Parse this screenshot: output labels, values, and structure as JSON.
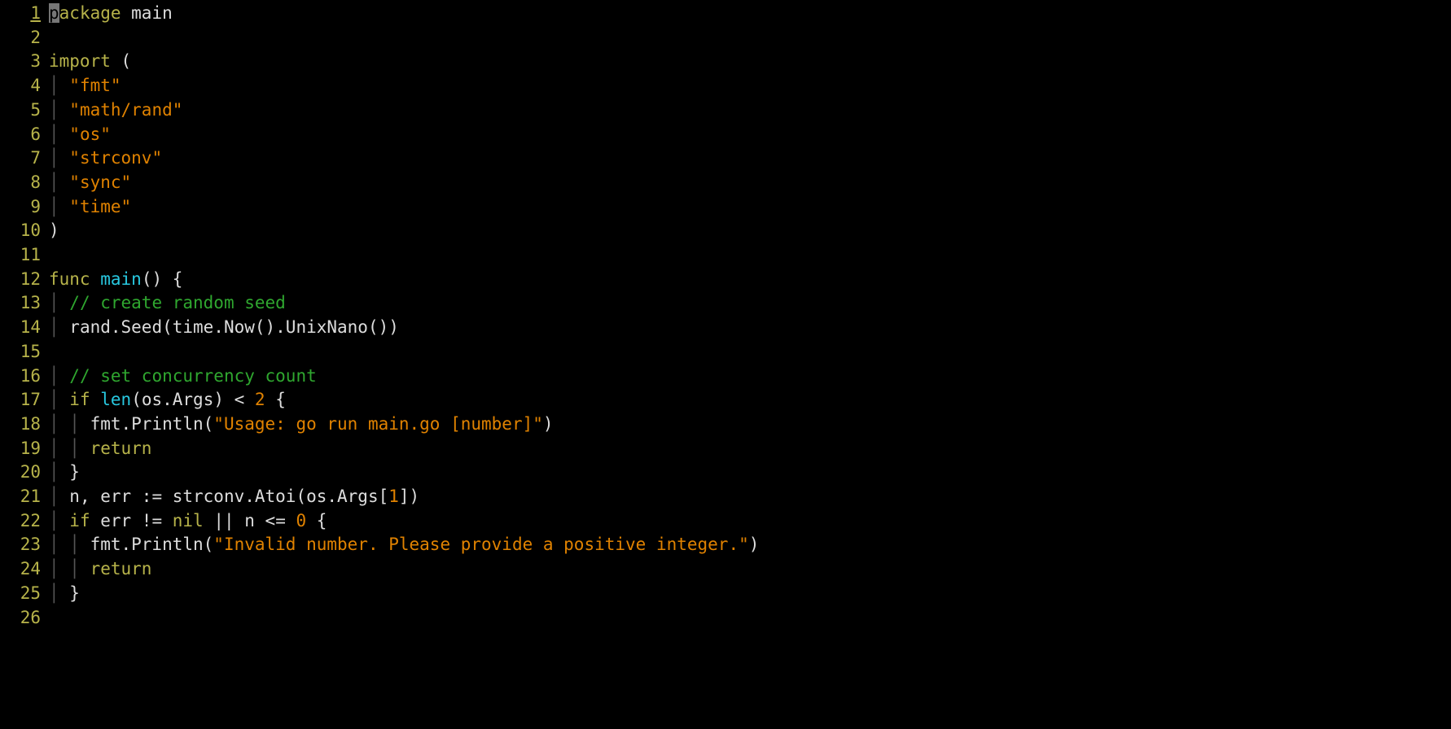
{
  "editor": {
    "cursor_line": 1,
    "lines": [
      {
        "n": 1,
        "tokens": [
          {
            "t": "cursor",
            "v": "p"
          },
          {
            "t": "kw",
            "v": "ackage"
          },
          {
            "t": "id",
            "v": " main"
          }
        ]
      },
      {
        "n": 2,
        "tokens": []
      },
      {
        "n": 3,
        "tokens": [
          {
            "t": "kw",
            "v": "import"
          },
          {
            "t": "id",
            "v": " "
          },
          {
            "t": "paren",
            "v": "("
          }
        ]
      },
      {
        "n": 4,
        "tokens": [
          {
            "t": "pipe",
            "v": "│ "
          },
          {
            "t": "str",
            "v": "\"fmt\""
          }
        ]
      },
      {
        "n": 5,
        "tokens": [
          {
            "t": "pipe",
            "v": "│ "
          },
          {
            "t": "str",
            "v": "\"math/rand\""
          }
        ]
      },
      {
        "n": 6,
        "tokens": [
          {
            "t": "pipe",
            "v": "│ "
          },
          {
            "t": "str",
            "v": "\"os\""
          }
        ]
      },
      {
        "n": 7,
        "tokens": [
          {
            "t": "pipe",
            "v": "│ "
          },
          {
            "t": "str",
            "v": "\"strconv\""
          }
        ]
      },
      {
        "n": 8,
        "tokens": [
          {
            "t": "pipe",
            "v": "│ "
          },
          {
            "t": "str",
            "v": "\"sync\""
          }
        ]
      },
      {
        "n": 9,
        "tokens": [
          {
            "t": "pipe",
            "v": "│ "
          },
          {
            "t": "str",
            "v": "\"time\""
          }
        ]
      },
      {
        "n": 10,
        "tokens": [
          {
            "t": "paren",
            "v": ")"
          }
        ]
      },
      {
        "n": 11,
        "tokens": []
      },
      {
        "n": 12,
        "tokens": [
          {
            "t": "kw",
            "v": "func"
          },
          {
            "t": "id",
            "v": " "
          },
          {
            "t": "builtin",
            "v": "main"
          },
          {
            "t": "paren",
            "v": "()"
          },
          {
            "t": "id",
            "v": " "
          },
          {
            "t": "paren",
            "v": "{"
          }
        ]
      },
      {
        "n": 13,
        "tokens": [
          {
            "t": "pipe",
            "v": "│ "
          },
          {
            "t": "cmt",
            "v": "// create random seed"
          }
        ]
      },
      {
        "n": 14,
        "tokens": [
          {
            "t": "pipe",
            "v": "│ "
          },
          {
            "t": "id",
            "v": "rand.Seed(time.Now().UnixNano())"
          }
        ]
      },
      {
        "n": 15,
        "tokens": []
      },
      {
        "n": 16,
        "tokens": [
          {
            "t": "pipe",
            "v": "│ "
          },
          {
            "t": "cmt",
            "v": "// set concurrency count"
          }
        ]
      },
      {
        "n": 17,
        "tokens": [
          {
            "t": "pipe",
            "v": "│ "
          },
          {
            "t": "kw",
            "v": "if"
          },
          {
            "t": "id",
            "v": " "
          },
          {
            "t": "builtin",
            "v": "len"
          },
          {
            "t": "id",
            "v": "(os.Args) < "
          },
          {
            "t": "num",
            "v": "2"
          },
          {
            "t": "id",
            "v": " "
          },
          {
            "t": "paren",
            "v": "{"
          }
        ]
      },
      {
        "n": 18,
        "tokens": [
          {
            "t": "pipe",
            "v": "│ │ "
          },
          {
            "t": "id",
            "v": "fmt.Println("
          },
          {
            "t": "str",
            "v": "\"Usage: go run main.go [number]\""
          },
          {
            "t": "id",
            "v": ")"
          }
        ]
      },
      {
        "n": 19,
        "tokens": [
          {
            "t": "pipe",
            "v": "│ │ "
          },
          {
            "t": "kw",
            "v": "return"
          }
        ]
      },
      {
        "n": 20,
        "tokens": [
          {
            "t": "pipe",
            "v": "│ "
          },
          {
            "t": "paren",
            "v": "}"
          }
        ]
      },
      {
        "n": 21,
        "tokens": [
          {
            "t": "pipe",
            "v": "│ "
          },
          {
            "t": "id",
            "v": "n, err := strconv.Atoi(os.Args["
          },
          {
            "t": "num",
            "v": "1"
          },
          {
            "t": "id",
            "v": "])"
          }
        ]
      },
      {
        "n": 22,
        "tokens": [
          {
            "t": "pipe",
            "v": "│ "
          },
          {
            "t": "kw",
            "v": "if"
          },
          {
            "t": "id",
            "v": " err != "
          },
          {
            "t": "kw",
            "v": "nil"
          },
          {
            "t": "id",
            "v": " || n <= "
          },
          {
            "t": "num",
            "v": "0"
          },
          {
            "t": "id",
            "v": " "
          },
          {
            "t": "paren",
            "v": "{"
          }
        ]
      },
      {
        "n": 23,
        "tokens": [
          {
            "t": "pipe",
            "v": "│ │ "
          },
          {
            "t": "id",
            "v": "fmt.Println("
          },
          {
            "t": "str",
            "v": "\"Invalid number. Please provide a positive integer.\""
          },
          {
            "t": "id",
            "v": ")"
          }
        ]
      },
      {
        "n": 24,
        "tokens": [
          {
            "t": "pipe",
            "v": "│ │ "
          },
          {
            "t": "kw",
            "v": "return"
          }
        ]
      },
      {
        "n": 25,
        "tokens": [
          {
            "t": "pipe",
            "v": "│ "
          },
          {
            "t": "paren",
            "v": "}"
          }
        ]
      },
      {
        "n": 26,
        "tokens": []
      }
    ]
  }
}
